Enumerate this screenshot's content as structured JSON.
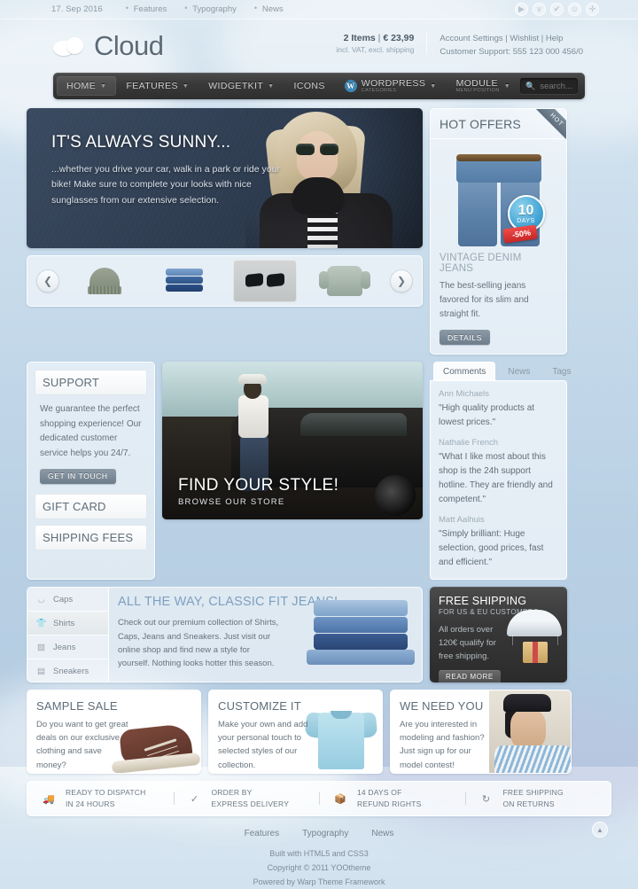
{
  "topbar": {
    "date": "17. Sep 2016",
    "links": [
      "Features",
      "Typography",
      "News"
    ],
    "social_icons": [
      "play-icon",
      "vimeo-icon",
      "check-icon",
      "user-icon",
      "plus-icon"
    ]
  },
  "header": {
    "logo_text": "Cloud",
    "cart_items": "2 Items",
    "cart_separator": "|",
    "cart_total": "€ 23,99",
    "cart_note": "incl. VAT, excl. shipping",
    "account_links": "Account Settings | Wishlist | Help",
    "support_line": "Customer Support: 555 123 000 456/0"
  },
  "nav": {
    "items": [
      {
        "label": "HOME",
        "caret": true,
        "active": true
      },
      {
        "label": "FEATURES",
        "caret": true,
        "active": false
      },
      {
        "label": "WIDGETKIT",
        "caret": true,
        "active": false
      },
      {
        "label": "ICONS",
        "caret": false,
        "active": false
      },
      {
        "label": "WORDPRESS",
        "sub": "CATEGORIES",
        "caret": true,
        "active": false,
        "badge": "W"
      },
      {
        "label": "MODULE",
        "sub": "MENU POSITION",
        "caret": true,
        "active": false
      }
    ],
    "search_placeholder": "search..."
  },
  "hero": {
    "title": "IT'S ALWAYS SUNNY...",
    "text": "...whether you drive your car, walk in a park or ride your bike! Make sure to complete your looks with nice sunglasses from our extensive selection."
  },
  "carousel": {
    "prev_icon": "chevron-left-icon",
    "next_icon": "chevron-right-icon",
    "thumbs": [
      "beanie-thumb",
      "jeans-stack-thumb",
      "sunglasses-thumb",
      "hoodie-thumb"
    ],
    "selected_index": 2
  },
  "hot_offers": {
    "heading": "HOT OFFERS",
    "ribbon": "HOT",
    "badge_days_number": "10",
    "badge_days_label": "DAYS",
    "badge_discount": "-50%",
    "product_title": "VINTAGE DENIM JEANS",
    "product_desc": "The best-selling jeans favored for its slim and straight fit.",
    "button": "DETAILS"
  },
  "support": {
    "heading": "SUPPORT",
    "text": "We guarantee the perfect shopping experience! Our dedicated customer service helps you 24/7.",
    "button": "GET IN TOUCH",
    "item2": "GIFT CARD",
    "item3": "SHIPPING FEES"
  },
  "style_banner": {
    "title": "FIND YOUR STYLE!",
    "subtitle": "BROWSE OUR STORE"
  },
  "comments_widget": {
    "tabs": [
      "Comments",
      "News",
      "Tags"
    ],
    "active_tab": "Comments",
    "comments": [
      {
        "name": "Ann Michaels",
        "text": "\"High quality products at lowest prices.\""
      },
      {
        "name": "Nathalie French",
        "text": "\"What I like most about this shop is the 24h support hotline. They are friendly and competent.\""
      },
      {
        "name": "Matt Aalhuis",
        "text": "\"Simply brilliant: Huge selection, good prices, fast and efficient.\""
      }
    ]
  },
  "promo": {
    "nav": [
      {
        "label": "Caps",
        "icon": "cap-icon",
        "active": false
      },
      {
        "label": "Shirts",
        "icon": "shirt-icon",
        "active": true
      },
      {
        "label": "Jeans",
        "icon": "jeans-icon",
        "active": false
      },
      {
        "label": "Sneakers",
        "icon": "sneaker-icon",
        "active": false
      }
    ],
    "title": "ALL THE WAY, CLASSIC FIT JEANS!",
    "text": "Check out our premium collection of Shirts, Caps, Jeans and Sneakers. Just visit our online shop and find new a style for yourself. Nothing looks hotter this season."
  },
  "free_shipping": {
    "title": "FREE SHIPPING",
    "subtitle": "FOR US & EU CUSTOMERS",
    "text": "All orders over 120€ qualify for free shipping.",
    "button": "READ MORE"
  },
  "cards": [
    {
      "title": "SAMPLE SALE",
      "text": "Do you want to get great deals on our exclusive clothing and save money?",
      "art": "sneaker"
    },
    {
      "title": "CUSTOMIZE IT",
      "text": "Make your own and add your personal touch to selected styles of our collection.",
      "art": "tshirt"
    },
    {
      "title": "WE NEED YOU",
      "text": "Are you interested in modeling and fashion? Just sign up for our model contest!",
      "art": "model"
    }
  ],
  "services": [
    {
      "icon": "truck-icon",
      "line1": "READY TO DISPATCH",
      "line2": "IN 24 HOURS"
    },
    {
      "icon": "clock-check-icon",
      "line1": "ORDER BY",
      "line2": "EXPRESS DELIVERY"
    },
    {
      "icon": "box-icon",
      "line1": "14 DAYS OF",
      "line2": "REFUND RIGHTS"
    },
    {
      "icon": "return-arrow-icon",
      "line1": "FREE SHIPPING",
      "line2": "ON RETURNS"
    }
  ],
  "footer": {
    "links": [
      "Features",
      "Typography",
      "News"
    ],
    "line1": "Built with HTML5 and CSS3",
    "line2": "Copyright © 2011 YOOtheme",
    "line3": "Powered by Warp Theme Framework",
    "to_top_icon": "arrow-up-icon"
  },
  "colors": {
    "accent_blue": "#7fa0c0",
    "nav_dark": "#383838",
    "badge_blue": "#3a9fd0",
    "discount_red": "#c92626"
  }
}
